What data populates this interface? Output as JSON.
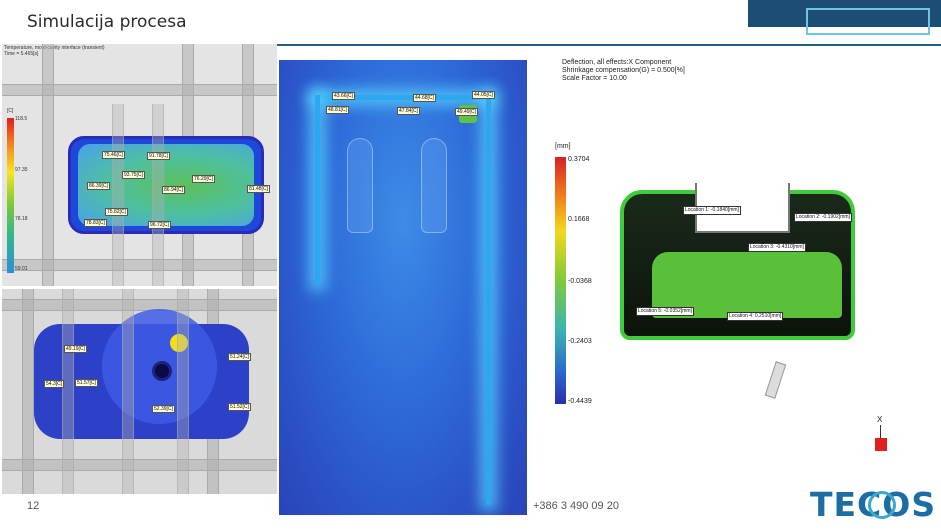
{
  "slide": {
    "title": "Simulacija procesa",
    "page_number": "12",
    "phone": "+386 3 490 09 20",
    "logo": "TECOS",
    "accent_color": "#1b4e72",
    "highlight_color": "#6fc3e3"
  },
  "panel_temperature": {
    "caption_line1": "Temperature, mold-cavity interface (transient)",
    "caption_line2": "Time = 5.465[s]",
    "unit": "[C]",
    "scale_ticks": [
      "118.5",
      "97.35",
      "78.18",
      "59.01"
    ],
    "labels": [
      "75.46[C]",
      "91.78[C]",
      "93.75[C]",
      "86.39[C]",
      "76.29[C]",
      "81.48[C]",
      "86.94[C]",
      "75.82[C]",
      "78.83[C]",
      "96.72[C]"
    ]
  },
  "panel_cooling": {
    "labels": [
      "49.19[C]",
      "51.24[C]",
      "54.3[C]",
      "51.57[C]",
      "52.39[C]",
      "51.52[C]"
    ]
  },
  "panel_center": {
    "labels": [
      "43.66[C]",
      "44.68[C]",
      "44.05[C]",
      "48.81[C]",
      "47.84[C]",
      "49.49[C]"
    ]
  },
  "panel_deflection": {
    "caption_line1": "Deflection, all effects:X Component",
    "caption_line2": "Shrinkage compensation(G) = 0.500[%]",
    "caption_line3": "Scale Factor = 10.00",
    "unit": "[mm]",
    "scale_ticks": [
      "0.3704",
      "0.1668",
      "-0.0368",
      "-0.2403",
      "-0.4439"
    ],
    "labels": [
      "Location 1: -0.1840[mm]",
      "Location 2: -0.1902[mm]",
      "Location 3: -0.4310[mm]",
      "Location 4: 0.2510[mm]",
      "Location 5: -0.0352[mm]"
    ],
    "axis_label": "X"
  }
}
